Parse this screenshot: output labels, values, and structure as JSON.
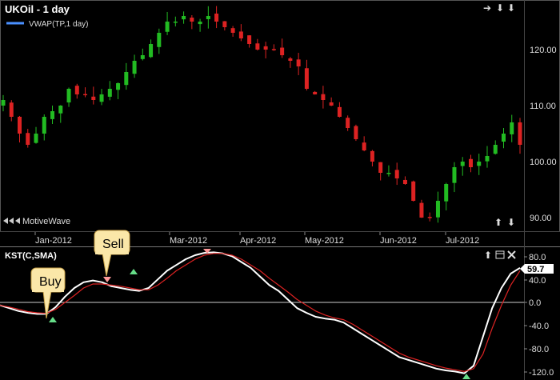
{
  "price_panel": {
    "title": "UKOil - 1 day",
    "indicator_legend": "VWAP(TP,1 day)",
    "brand": "MotiveWave",
    "nav_arrows": [
      "➔",
      "⬇",
      "⬇",
      "⬆"
    ],
    "y_ticks": [
      "120.00",
      "110.00",
      "100.00",
      "90.00"
    ]
  },
  "time_axis": {
    "labels": [
      "Jan-2012",
      "Mar-2012",
      "Apr-2012",
      "May-2012",
      "Jun-2012",
      "Jul-2012"
    ]
  },
  "kst_panel": {
    "title": "KST(C,SMA)",
    "y_ticks": [
      "80.0",
      "40.0",
      "0.0",
      "-40.0",
      "-80.0",
      "-120.0"
    ],
    "current_value": "59.7",
    "callouts": {
      "buy": "Buy",
      "sell": "Sell"
    }
  },
  "colors": {
    "up_candle": "#22bb22",
    "down_candle": "#dd2222",
    "vwap_legend": "#4a90ff",
    "kst_line": "#ffffff",
    "signal_line": "#dd2222",
    "buy_marker": "#66dd88",
    "sell_marker": "#ff9999"
  },
  "chart_data": [
    {
      "type": "candlestick",
      "title": "UKOil - 1 day",
      "x_tick_labels": [
        "Jan-2012",
        "Mar-2012",
        "Apr-2012",
        "May-2012",
        "Jun-2012",
        "Jul-2012"
      ],
      "ylim": [
        88,
        128
      ],
      "y_ticks": [
        90,
        100,
        110,
        120
      ],
      "grid": false,
      "approx_closes": [
        111,
        108,
        105,
        103,
        105,
        108,
        109,
        110,
        113,
        112,
        112,
        111,
        112,
        113,
        114,
        116,
        118,
        119,
        121,
        123,
        125,
        125,
        126,
        125,
        125,
        126,
        125,
        124,
        123,
        122,
        121,
        120,
        120,
        120,
        119,
        118,
        117,
        113,
        112,
        111,
        110,
        108,
        106,
        104,
        102,
        100,
        98,
        98,
        97,
        96,
        93,
        90,
        90,
        93,
        96,
        99,
        100,
        99,
        100,
        101,
        103,
        105,
        107,
        103
      ]
    },
    {
      "type": "line",
      "title": "KST(C,SMA)",
      "ylim": [
        -130,
        90
      ],
      "y_ticks": [
        80,
        40,
        0,
        -40,
        -80,
        -120
      ],
      "grid": false,
      "series": [
        {
          "values": [
            -5,
            -10,
            -15,
            -18,
            -20,
            -20,
            -8,
            10,
            25,
            35,
            38,
            35,
            28,
            25,
            22,
            20,
            25,
            40,
            55,
            65,
            75,
            82,
            86,
            87,
            85,
            80,
            70,
            60,
            45,
            30,
            20,
            5,
            -10,
            -18,
            -25,
            -28,
            -30,
            -35,
            -45,
            -55,
            -65,
            -75,
            -85,
            -95,
            -100,
            -105,
            -110,
            -115,
            -118,
            -120,
            -123,
            -110,
            -60,
            -10,
            25,
            50,
            60
          ]
        },
        {
          "values": [
            -5,
            -8,
            -12,
            -16,
            -18,
            -19,
            -12,
            0,
            12,
            25,
            32,
            32,
            30,
            28,
            25,
            22,
            22,
            30,
            42,
            55,
            65,
            75,
            82,
            85,
            85,
            82,
            75,
            65,
            55,
            42,
            30,
            18,
            5,
            -5,
            -15,
            -22,
            -27,
            -30,
            -38,
            -48,
            -58,
            -68,
            -78,
            -88,
            -95,
            -100,
            -105,
            -110,
            -114,
            -117,
            -120,
            -115,
            -90,
            -45,
            -5,
            30,
            55
          ]
        }
      ],
      "annotations": [
        {
          "label": "Buy",
          "type": "buy"
        },
        {
          "label": "Sell",
          "type": "sell"
        }
      ],
      "current_value": 59.7
    }
  ]
}
